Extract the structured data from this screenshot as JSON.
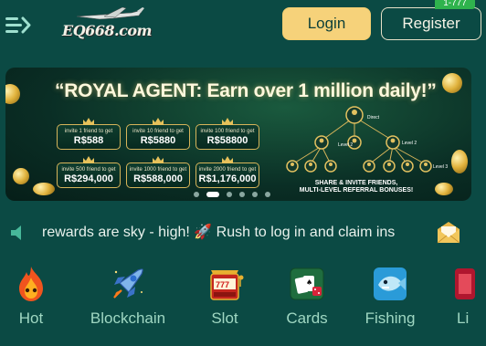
{
  "header": {
    "logo_text": "EQ668.com",
    "login_label": "Login",
    "register_label": "Register",
    "register_badge": "1-777"
  },
  "banner": {
    "title": "“ROYAL AGENT: Earn over 1 million daily!”",
    "tiles": [
      {
        "caption": "invite 1 friend to get",
        "amount": "R$588"
      },
      {
        "caption": "invite 10 friend to get",
        "amount": "R$5880"
      },
      {
        "caption": "invite 100 friend to get",
        "amount": "R$58800"
      },
      {
        "caption": "invite 500 friend to get",
        "amount": "R$294,000"
      },
      {
        "caption": "invite 1000 friend to get",
        "amount": "R$588,000"
      },
      {
        "caption": "invite 2000 friend to get",
        "amount": "R$1,176,000"
      }
    ],
    "tree": {
      "direct": "Direct",
      "level2": "Level 2",
      "level2b": "Level 2",
      "level3": "Level 3"
    },
    "share_line1": "SHARE & INVITE FRIENDS,",
    "share_line2": "MULTI-LEVEL REFERRAL BONUSES!",
    "slides_count": 6,
    "active_slide": 2
  },
  "marquee": {
    "text": "rewards are sky - high! 🚀 Rush to log in and claim ins"
  },
  "categories": [
    {
      "label": "Hot",
      "icon": "flame-icon"
    },
    {
      "label": "Blockchain",
      "icon": "rocket-icon"
    },
    {
      "label": "Slot",
      "icon": "slot-machine-icon"
    },
    {
      "label": "Cards",
      "icon": "cards-icon"
    },
    {
      "label": "Fishing",
      "icon": "fish-icon"
    },
    {
      "label": "Li",
      "icon": "live-icon"
    }
  ],
  "colors": {
    "background": "#0b4a44",
    "login_bg": "#f6d27a",
    "badge": "#2fb34d",
    "category_text": "#9fd7c2"
  }
}
